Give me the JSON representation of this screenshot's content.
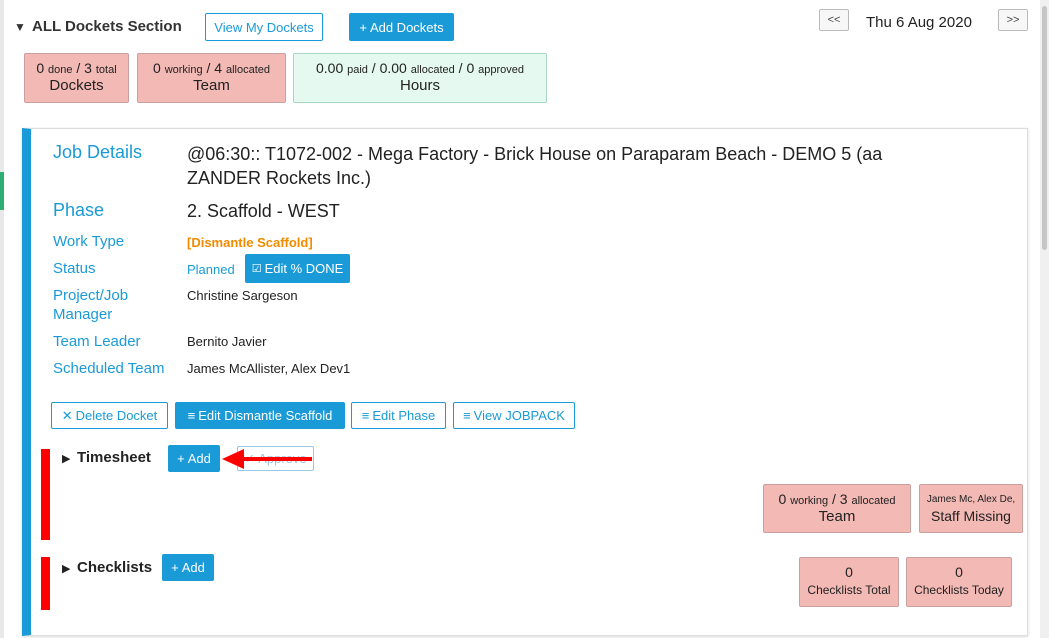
{
  "header": {
    "title": "ALL Dockets Section",
    "view_my_dockets": "View My Dockets",
    "add_dockets": "Add Dockets",
    "prev": "<<",
    "next": ">>",
    "date": "Thu 6 Aug 2020"
  },
  "stats": {
    "dockets": {
      "n1": "0",
      "w1": "done",
      "n2": "3",
      "w2": "total",
      "label": "Dockets"
    },
    "team": {
      "n1": "0",
      "w1": "working",
      "n2": "4",
      "w2": "allocated",
      "label": "Team"
    },
    "hours": {
      "n1": "0.00",
      "w1": "paid",
      "n2": "0.00",
      "w2": "allocated",
      "n3": "0",
      "w3": "approved",
      "label": "Hours"
    }
  },
  "job": {
    "job_details_label": "Job Details",
    "job_details_value_1": "@06:30:: T1072-002 - Mega Factory - Brick House on Paraparam Beach - DEMO 5 (aa",
    "job_details_value_2": "ZANDER Rockets Inc.)",
    "phase_label": "Phase",
    "phase_value": "2. Scaffold - WEST",
    "work_type_label": "Work Type",
    "work_type_value": "[Dismantle Scaffold]",
    "status_label": "Status",
    "status_value": "Planned",
    "edit_done": "Edit % DONE",
    "pm_label_1": "Project/Job",
    "pm_label_2": "Manager",
    "pm_value": "Christine Sargeson",
    "leader_label": "Team Leader",
    "leader_value": "Bernito Javier",
    "sched_label": "Scheduled Team",
    "sched_value": "James McAllister, Alex Dev1"
  },
  "actions": {
    "delete": "Delete Docket",
    "edit_dismantle": "Edit Dismantle Scaffold",
    "edit_phase": "Edit Phase",
    "view_jobpack": "View JOBPACK"
  },
  "timesheet": {
    "title": "Timesheet",
    "add": "Add",
    "approve": "Approve",
    "team_stat": {
      "n1": "0",
      "w1": "working",
      "n2": "3",
      "w2": "allocated",
      "label": "Team"
    },
    "missing_stat": {
      "names": "James Mc, Alex De,",
      "label": "Staff Missing"
    }
  },
  "checklists": {
    "title": "Checklists",
    "add": "Add",
    "total": {
      "n": "0",
      "label": "Checklists Total"
    },
    "today": {
      "n": "0",
      "label": "Checklists Today"
    }
  },
  "colors": {
    "accent": "#1a9bd7",
    "stat_red": "#f3b9b5",
    "stat_green": "#e6f9f1",
    "work_type": "#f28b00",
    "annotation_red": "#ff0000"
  }
}
